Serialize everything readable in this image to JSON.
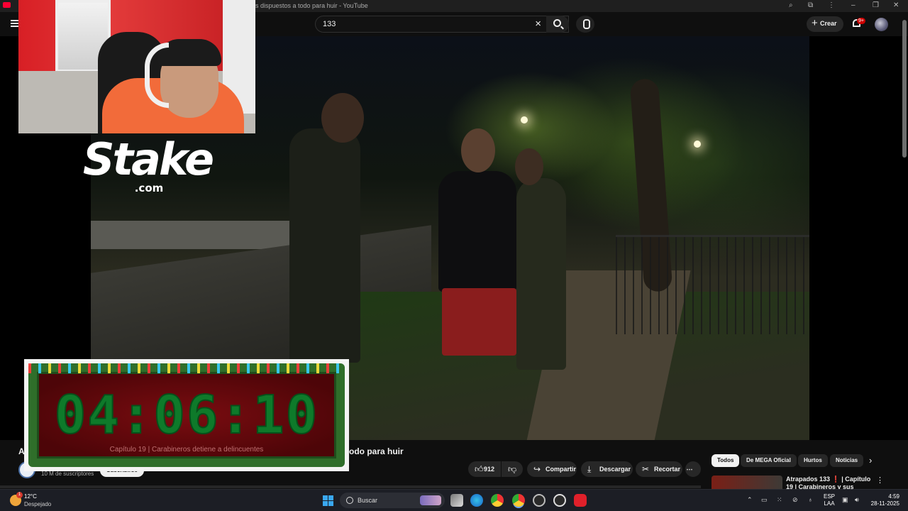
{
  "browser": {
    "window_title": "es dispuestos a todo para huir - YouTube"
  },
  "youtube": {
    "search_value": "133",
    "create_label": "Crear",
    "notification_badge": "9+"
  },
  "overlays": {
    "sponsor_word": "Stake",
    "sponsor_sub": ".com",
    "timer_value": "04:06:10",
    "timer_caption": "Capítulo 19 | Carabineros detiene a delincuentes"
  },
  "video": {
    "title_start": "A",
    "title_end": "odo para huir",
    "subscribers": "10 M de suscriptores",
    "subscribe_label": "Suscribirse",
    "likes": "912",
    "actions": {
      "share": "Compartir",
      "download": "Descargar",
      "clip": "Recortar"
    }
  },
  "chips": [
    "Todos",
    "De MEGA Oficial",
    "Hurtos",
    "Noticias"
  ],
  "recommendation": {
    "title": "Atrapados 133 ❗ | Capítulo 19 | Carabineros y sus"
  },
  "taskbar": {
    "temperature": "12°C",
    "condition": "Despejado",
    "search_label": "Buscar",
    "language_top": "ESP",
    "language_bottom": "LAA",
    "time": "4:59",
    "date": "28-11-2025"
  }
}
